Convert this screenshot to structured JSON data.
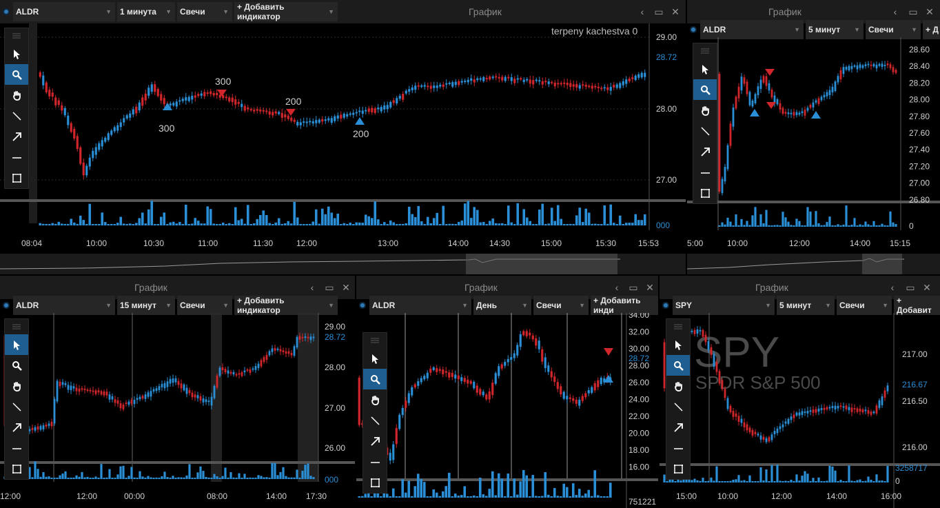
{
  "colors": {
    "up": "#2a8fd6",
    "down": "#d0262c",
    "accent": "#2e79b8",
    "grid": "#3a3a3a",
    "volume": "#2a8fd6"
  },
  "icons": [
    "cursor-arrow-icon",
    "search-zoom-icon",
    "hand-pan-icon",
    "line-tool-icon",
    "arrow-tool-icon",
    "horizontal-line-icon",
    "rectangle-icon"
  ],
  "panels": [
    {
      "title": "График",
      "symbol": "ALDR",
      "interval": "1 минута",
      "type": "Свечи",
      "add_indicator": "+ Добавить индикатор",
      "overlay": "terpeny kachestva  0",
      "y_ticks": [
        "29.00",
        "28.00",
        "27.00"
      ],
      "price_tag": "28.72",
      "volume_tag": "000",
      "x_ticks": [
        "08:04",
        "10:00",
        "10:30",
        "11:00",
        "11:30",
        "12:00",
        "13:00",
        "14:00",
        "14:30",
        "15:00",
        "15:30",
        "15:53"
      ],
      "markers": [
        {
          "label": "300",
          "dir": "up"
        },
        {
          "label": "300",
          "dir": "down"
        },
        {
          "label": "200",
          "dir": "down"
        },
        {
          "label": "200",
          "dir": "up"
        }
      ]
    },
    {
      "title": "График",
      "symbol": "ALDR",
      "interval": "5 минут",
      "type": "Свечи",
      "add_indicator": "+ Д",
      "y_ticks": [
        "28.60",
        "28.40",
        "28.20",
        "28.00",
        "27.80",
        "27.60",
        "27.40",
        "27.20",
        "27.00",
        "26.80"
      ],
      "volume_tag": "0",
      "x_ticks": [
        "5:00",
        "10:00",
        "12:00",
        "14:00",
        "15:15"
      ]
    },
    {
      "title": "График",
      "symbol": "ALDR",
      "interval": "15 минут",
      "type": "Свечи",
      "add_indicator": "+ Добавить индикатор",
      "y_ticks": [
        "29.00",
        "28.00",
        "27.00",
        "26.00"
      ],
      "price_tag": "28.72",
      "volume_tag": "000",
      "x_ticks": [
        "12:00",
        "12:00",
        "00:00",
        "08:00",
        "14:00",
        "17:30"
      ]
    },
    {
      "title": "График",
      "symbol": "ALDR",
      "interval": "День",
      "type": "Свечи",
      "add_indicator": "+ Добавить инди",
      "y_ticks": [
        "34.00",
        "32.00",
        "30.00",
        "28.00",
        "26.00",
        "24.00",
        "22.00",
        "20.00",
        "18.00",
        "16.00"
      ],
      "price_tag": "28.72",
      "volume_tag": "751221"
    },
    {
      "title": "График",
      "symbol": "SPY",
      "interval": "5 минут",
      "type": "Свечи",
      "add_indicator": "+ Добавит",
      "watermark_symbol": "SPY",
      "watermark_name": "SPDR S&P 500",
      "y_ticks": [
        "217.00",
        "216.50",
        "216.00"
      ],
      "price_tag": "216.67",
      "volume_tag": "3258717",
      "volume_zero": "0",
      "x_ticks": [
        "15:00",
        "10:00",
        "12:00",
        "14:00",
        "16:00"
      ]
    }
  ]
}
